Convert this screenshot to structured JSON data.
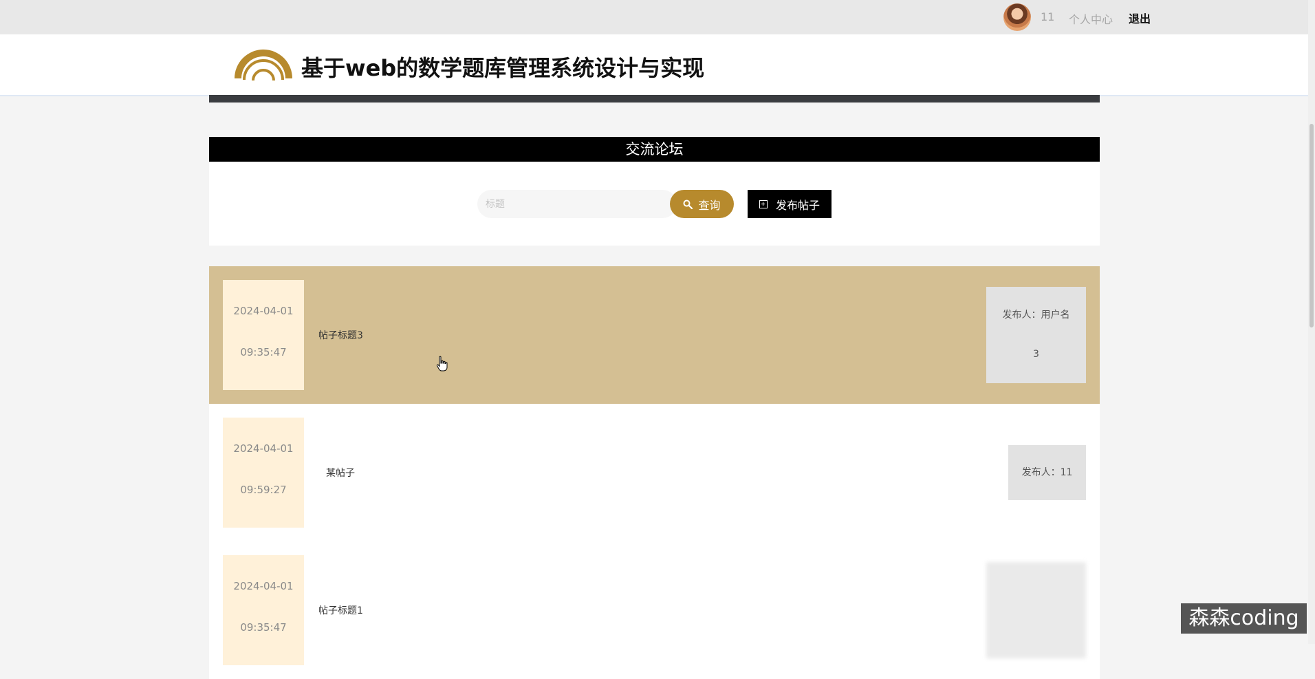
{
  "topbar": {
    "username": "11",
    "personal_center": "个人中心",
    "logout": "退出"
  },
  "header": {
    "site_title": "基于web的数学题库管理系统设计与实现"
  },
  "forum": {
    "title": "交流论坛",
    "search_placeholder": "标题",
    "search_button": "查询",
    "publish_button": "发布帖子"
  },
  "posts": [
    {
      "date": "2024-04-01",
      "time": "09:35:47",
      "title": "帖子标题3",
      "author": "发布人：用户名",
      "count": "3"
    },
    {
      "date": "2024-04-01",
      "time": "09:59:27",
      "title": "某帖子",
      "author": "发布人：11"
    },
    {
      "date": "2024-04-01",
      "time": "09:35:47",
      "title": "帖子标题1"
    }
  ],
  "watermark": "森森coding",
  "colors": {
    "accent": "#b78a2d",
    "active_row": "#d4bf93",
    "date_box": "#fff1d9",
    "title_bar": "#000000"
  }
}
